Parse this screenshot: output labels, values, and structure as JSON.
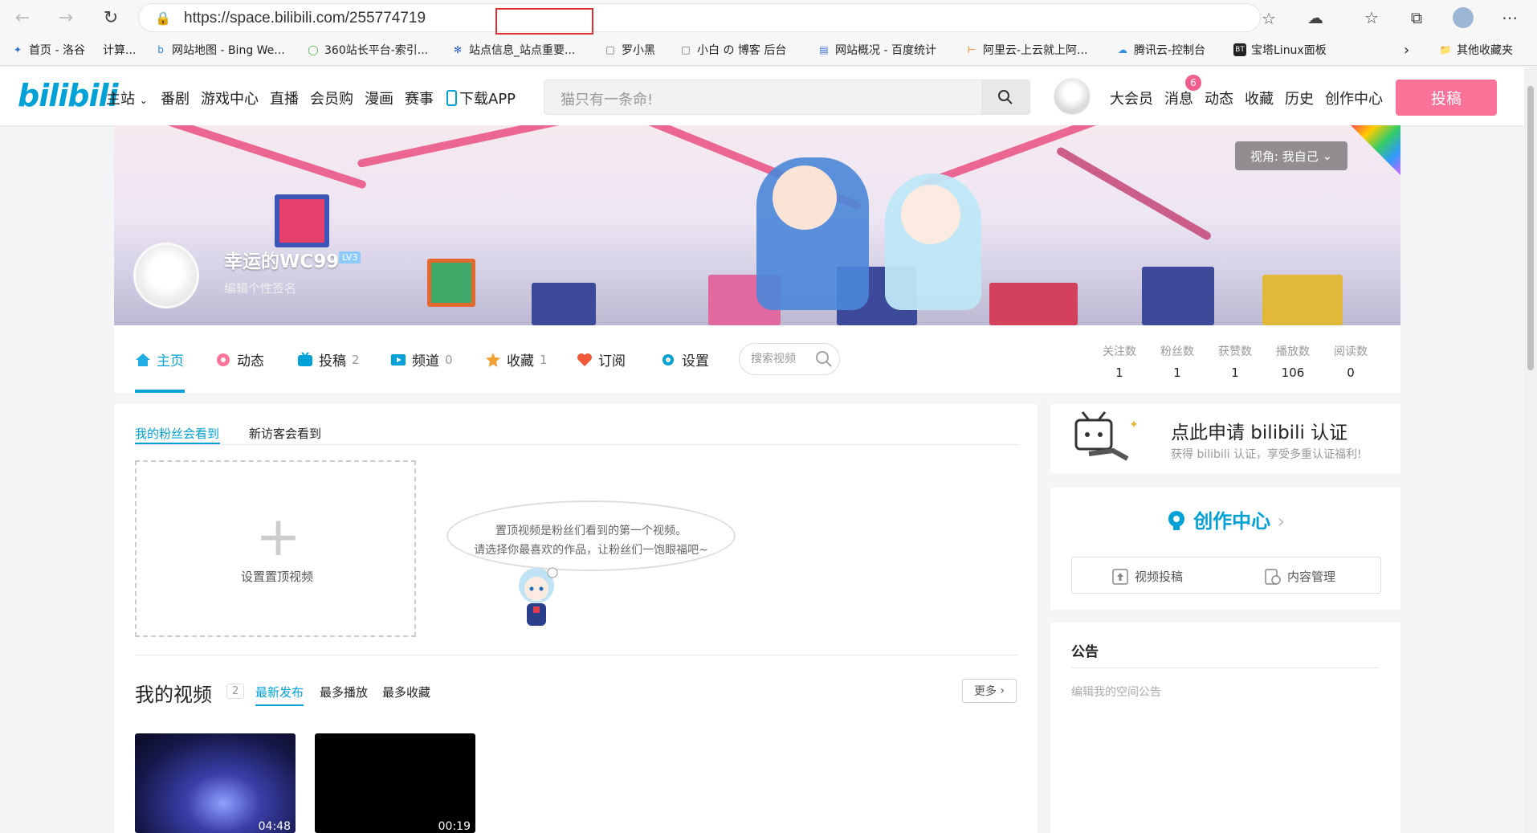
{
  "browser": {
    "url": "https://space.bilibili.com/",
    "url_highlight": "255774719"
  },
  "bookmarks": [
    {
      "icon": "bookmark-luogu-icon",
      "label": "首页 - 洛谷",
      "color": "#2b6cd8"
    },
    {
      "icon": "",
      "label": "计算...",
      "color": ""
    },
    {
      "icon": "bing-icon",
      "label": "网站地图 - Bing We...",
      "color": "#2a8be0"
    },
    {
      "icon": "360-icon",
      "label": "360站长平台-索引...",
      "color": "#4bb34b"
    },
    {
      "icon": "baidu-paw-icon",
      "label": "站点信息_站点重要...",
      "color": "#2b5bd8"
    },
    {
      "icon": "page-icon",
      "label": "罗小黑",
      "color": "#666"
    },
    {
      "icon": "page-icon",
      "label": "小白 の 博客 后台",
      "color": "#666"
    },
    {
      "icon": "stats-icon",
      "label": "网站概况 - 百度统计",
      "color": "#3c6fd8"
    },
    {
      "icon": "aliyun-icon",
      "label": "阿里云-上云就上阿...",
      "color": "#ff6a00"
    },
    {
      "icon": "tencent-cloud-icon",
      "label": "腾讯云-控制台",
      "color": "#2f8fe0"
    },
    {
      "icon": "bt-icon",
      "label": "宝塔Linux面板",
      "color": "#222"
    }
  ],
  "bookmarks_other": "其他收藏夹",
  "header": {
    "logo": "bilibili",
    "nav": [
      "主站",
      "番剧",
      "游戏中心",
      "直播",
      "会员购",
      "漫画",
      "赛事",
      "下载APP"
    ],
    "search_placeholder": "猫只有一条命!",
    "right_nav": [
      "大会员",
      "消息",
      "动态",
      "收藏",
      "历史",
      "创作中心"
    ],
    "message_badge": "6",
    "upload": "投稿",
    "accent": "#fb7299",
    "brand": "#00a1d6"
  },
  "banner": {
    "view_as": "视角:  我自己",
    "username": "幸运的WC99",
    "level": "LV3",
    "signature": "编辑个性签名"
  },
  "tabs": [
    {
      "label": "主页",
      "count": "",
      "icon": "home-icon",
      "color": "#23ade5"
    },
    {
      "label": "动态",
      "count": "",
      "icon": "flower-icon",
      "color": "#fb7299"
    },
    {
      "label": "投稿",
      "count": "2",
      "icon": "tv-icon",
      "color": "#00a1d6"
    },
    {
      "label": "频道",
      "count": "0",
      "icon": "channel-icon",
      "color": "#00a1d6"
    },
    {
      "label": "收藏",
      "count": "1",
      "icon": "star-icon",
      "color": "#f3a034"
    },
    {
      "label": "订阅",
      "count": "",
      "icon": "heart-icon",
      "color": "#f35a3a"
    },
    {
      "label": "设置",
      "count": "",
      "icon": "gear-icon",
      "color": "#00a1d6"
    }
  ],
  "video_search_placeholder": "搜索视频",
  "stats": [
    {
      "label": "关注数",
      "value": "1"
    },
    {
      "label": "粉丝数",
      "value": "1"
    },
    {
      "label": "获赞数",
      "value": "1"
    },
    {
      "label": "播放数",
      "value": "106"
    },
    {
      "label": "阅读数",
      "value": "0"
    }
  ],
  "main": {
    "subtabs": [
      "我的粉丝会看到",
      "新访客会看到"
    ],
    "set_top_label": "设置置顶视频",
    "bubble_line1": "置顶视频是粉丝们看到的第一个视频。",
    "bubble_line2": "请选择你最喜欢的作品，让粉丝们一饱眼福吧~",
    "my_videos_title": "我的视频",
    "video_count": "2",
    "sorts": [
      "最新发布",
      "最多播放",
      "最多收藏"
    ],
    "more": "更多",
    "videos": [
      {
        "duration": "04:48"
      },
      {
        "duration": "00:19"
      }
    ]
  },
  "right": {
    "cert_title": "点此申请 bilibili 认证",
    "cert_sub": "获得 bilibili 认证，享受多重认证福利!",
    "creator_title": "创作中心",
    "creator_actions": [
      "视频投稿",
      "内容管理"
    ],
    "notice_title": "公告",
    "notice_edit": "编辑我的空间公告"
  }
}
